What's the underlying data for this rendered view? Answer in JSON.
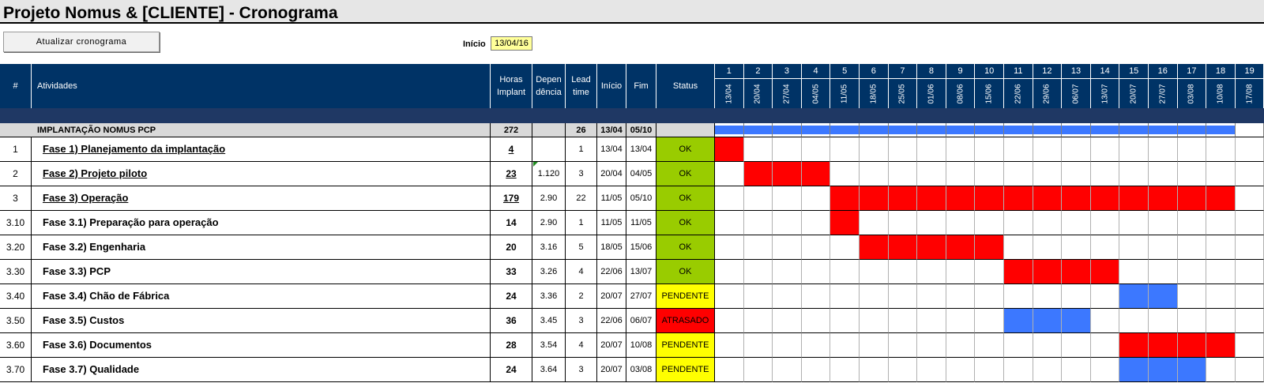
{
  "title": "Projeto Nomus & [CLIENTE] - Cronograma",
  "update_button": "Atualizar cronograma",
  "start": {
    "label": "Início",
    "value": "13/04/16"
  },
  "headers": {
    "num": "#",
    "activities": "Atividades",
    "hours_l1": "Horas",
    "hours_l2": "Implant",
    "dep_l1": "Depen",
    "dep_l2": "dência",
    "lead_l1": "Lead",
    "lead_l2": "time",
    "start": "Início",
    "end": "Fim",
    "status": "Status"
  },
  "weeks": [
    {
      "n": "1",
      "d": "13/04"
    },
    {
      "n": "2",
      "d": "20/04"
    },
    {
      "n": "3",
      "d": "27/04"
    },
    {
      "n": "4",
      "d": "04/05"
    },
    {
      "n": "5",
      "d": "11/05"
    },
    {
      "n": "6",
      "d": "18/05"
    },
    {
      "n": "7",
      "d": "25/05"
    },
    {
      "n": "8",
      "d": "01/06"
    },
    {
      "n": "9",
      "d": "08/06"
    },
    {
      "n": "10",
      "d": "15/06"
    },
    {
      "n": "11",
      "d": "22/06"
    },
    {
      "n": "12",
      "d": "29/06"
    },
    {
      "n": "13",
      "d": "06/07"
    },
    {
      "n": "14",
      "d": "13/07"
    },
    {
      "n": "15",
      "d": "20/07"
    },
    {
      "n": "16",
      "d": "27/07"
    },
    {
      "n": "17",
      "d": "03/08"
    },
    {
      "n": "18",
      "d": "10/08"
    },
    {
      "n": "19",
      "d": "17/08"
    }
  ],
  "summary": {
    "name": "IMPLANTAÇÃO NOMUS PCP",
    "hours": "272",
    "lead": "26",
    "start": "13/04",
    "end": "05/10",
    "bar": {
      "from": 1,
      "to": 18
    }
  },
  "rows": [
    {
      "num": "1",
      "name": "Fase 1) Planejamento da implantação",
      "hours": "4",
      "dep": "",
      "lead": "1",
      "start": "13/04",
      "end": "13/04",
      "status": "OK",
      "link": true,
      "bar": {
        "from": 1,
        "to": 1,
        "color": "red"
      }
    },
    {
      "num": "2",
      "name": "Fase 2) Projeto piloto",
      "hours": "23",
      "dep": "1.120",
      "lead": "3",
      "start": "20/04",
      "end": "04/05",
      "status": "OK",
      "link": true,
      "bar": {
        "from": 2,
        "to": 4,
        "color": "red"
      }
    },
    {
      "num": "3",
      "name": "Fase 3) Operação",
      "hours": "179",
      "dep": "2.90",
      "lead": "22",
      "start": "11/05",
      "end": "05/10",
      "status": "OK",
      "link": true,
      "bar": {
        "from": 5,
        "to": 18,
        "color": "red"
      }
    },
    {
      "num": "3.10",
      "name": "Fase 3.1) Preparação para operação",
      "hours": "14",
      "dep": "2.90",
      "lead": "1",
      "start": "11/05",
      "end": "11/05",
      "status": "OK",
      "link": false,
      "bar": {
        "from": 5,
        "to": 5,
        "color": "red"
      }
    },
    {
      "num": "3.20",
      "name": "Fase 3.2) Engenharia",
      "hours": "20",
      "dep": "3.16",
      "lead": "5",
      "start": "18/05",
      "end": "15/06",
      "status": "OK",
      "link": false,
      "bar": {
        "from": 6,
        "to": 10,
        "color": "red"
      }
    },
    {
      "num": "3.30",
      "name": "Fase 3.3) PCP",
      "hours": "33",
      "dep": "3.26",
      "lead": "4",
      "start": "22/06",
      "end": "13/07",
      "status": "OK",
      "link": false,
      "bar": {
        "from": 11,
        "to": 14,
        "color": "red"
      }
    },
    {
      "num": "3.40",
      "name": "Fase 3.4) Chão de Fábrica",
      "hours": "24",
      "dep": "3.36",
      "lead": "2",
      "start": "20/07",
      "end": "27/07",
      "status": "PENDENTE",
      "link": false,
      "bar": {
        "from": 15,
        "to": 16,
        "color": "blue"
      }
    },
    {
      "num": "3.50",
      "name": "Fase 3.5) Custos",
      "hours": "36",
      "dep": "3.45",
      "lead": "3",
      "start": "22/06",
      "end": "06/07",
      "status": "ATRASADO",
      "link": false,
      "bar": {
        "from": 11,
        "to": 13,
        "color": "blue"
      }
    },
    {
      "num": "3.60",
      "name": "Fase 3.6) Documentos",
      "hours": "28",
      "dep": "3.54",
      "lead": "4",
      "start": "20/07",
      "end": "10/08",
      "status": "PENDENTE",
      "link": false,
      "bar": {
        "from": 15,
        "to": 18,
        "color": "red"
      }
    },
    {
      "num": "3.70",
      "name": "Fase 3.7) Qualidade",
      "hours": "24",
      "dep": "3.64",
      "lead": "3",
      "start": "20/07",
      "end": "03/08",
      "status": "PENDENTE",
      "link": false,
      "bar": {
        "from": 15,
        "to": 17,
        "color": "blue"
      }
    }
  ],
  "colors": {
    "header_bg": "#003366",
    "bar_red": "#ff0000",
    "bar_blue": "#3c78ff",
    "status_ok": "#99cc00",
    "status_pendente": "#ffff00",
    "status_atrasado": "#ff0000",
    "start_highlight": "#ffff99"
  }
}
